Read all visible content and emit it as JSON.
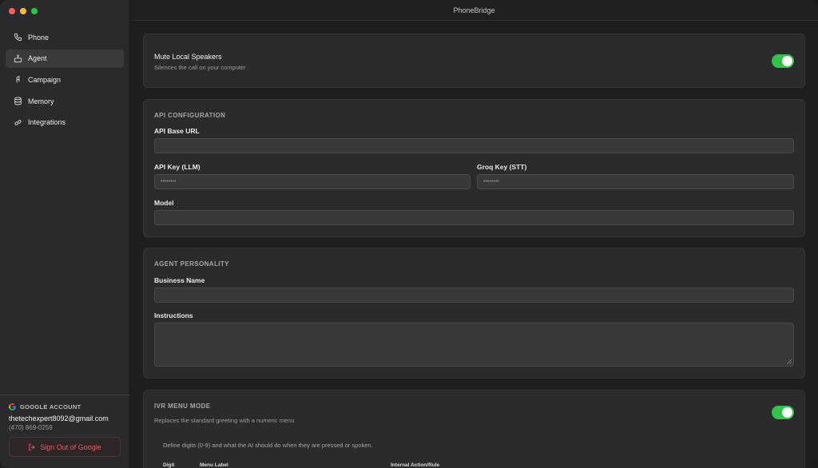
{
  "window": {
    "title": "PhoneBridge",
    "traffic_colors": [
      "#ff5f57",
      "#febc2e",
      "#28c840"
    ]
  },
  "sidebar": {
    "items": [
      {
        "label": "Phone",
        "icon": "phone-icon"
      },
      {
        "label": "Agent",
        "icon": "agent-icon",
        "active": true
      },
      {
        "label": "Campaign",
        "icon": "campaign-icon"
      },
      {
        "label": "Memory",
        "icon": "database-icon"
      },
      {
        "label": "Integrations",
        "icon": "link-icon"
      }
    ],
    "account": {
      "heading": "GOOGLE ACCOUNT",
      "email": "thetechexpert8092@gmail.com",
      "phone": "(470) 869-0259",
      "signout_label": "Sign Out of Google"
    }
  },
  "mute": {
    "title": "Mute Local Speakers",
    "subtitle": "Silences the call on your computer",
    "enabled": true
  },
  "api": {
    "section_title": "API CONFIGURATION",
    "base_url_label": "API Base URL",
    "base_url_value": "",
    "llm_key_label": "API Key (LLM)",
    "llm_key_value": "••••••••",
    "groq_key_label": "Groq Key (STT)",
    "groq_key_value": "••••••••",
    "model_label": "Model",
    "model_value": ""
  },
  "personality": {
    "section_title": "AGENT PERSONALITY",
    "business_label": "Business Name",
    "business_value": "",
    "instructions_label": "Instructions",
    "instructions_value": ""
  },
  "ivr": {
    "section_title": "IVR MENU MODE",
    "subtitle": "Replaces the standard greeting with a numeric menu",
    "enabled": true,
    "help_text": "Define digits (0-9) and what the AI should do when they are pressed or spoken.",
    "columns": [
      "Digit",
      "Menu Label",
      "Internal Action/Rule"
    ]
  },
  "colors": {
    "accent_green": "#35c24a",
    "danger_red": "#f05a5a"
  }
}
